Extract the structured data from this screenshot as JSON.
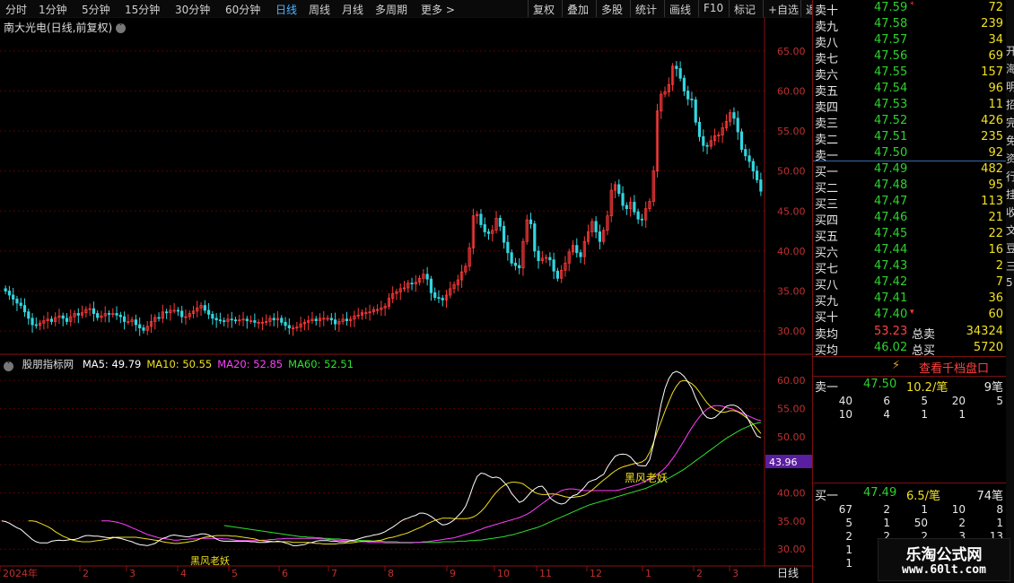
{
  "toolbar": {
    "periods": [
      "分时",
      "1分钟",
      "5分钟",
      "15分钟",
      "30分钟",
      "60分钟",
      "日线",
      "周线",
      "月线",
      "多周期",
      "更多 >"
    ],
    "active_period": "日线",
    "actions": [
      "复权",
      "叠加",
      "多股",
      "统计",
      "画线",
      "F10",
      "标记",
      "+自选",
      "返回"
    ]
  },
  "main_chart": {
    "title": "南大光电(日线,前复权)",
    "y_ticks": [
      "65.00",
      "60.00",
      "55.00",
      "50.00",
      "45.00",
      "40.00",
      "35.00",
      "30.00"
    ],
    "y_values": [
      65,
      60,
      55,
      50,
      45,
      40,
      35,
      30
    ],
    "ylim": [
      28,
      67
    ]
  },
  "indicator_chart": {
    "name": "股朋指标网",
    "ma_labels": [
      {
        "text": "MA5: 49.79",
        "color": "#ffffff"
      },
      {
        "text": "MA10: 50.55",
        "color": "#f0e020"
      },
      {
        "text": "MA20: 52.85",
        "color": "#ff40ff"
      },
      {
        "text": "MA60: 52.51",
        "color": "#30e030"
      }
    ],
    "y_ticks": [
      "60.00",
      "55.00",
      "50.00",
      "45.00",
      "40.00",
      "35.00",
      "30.00"
    ],
    "y_values": [
      60,
      55,
      50,
      45,
      40,
      35,
      30
    ],
    "ylim": [
      27,
      64
    ],
    "highlight_value": "43.96",
    "annotations": [
      "黑风老妖",
      "黑风老妖"
    ]
  },
  "x_axis": {
    "labels": [
      "2024年",
      "2",
      "3",
      "4",
      "5",
      "6",
      "7",
      "8",
      "9",
      "10",
      "11",
      "12",
      "1",
      "2",
      "3"
    ],
    "right_label": "日线"
  },
  "chart_data": [
    {
      "type": "candlestick",
      "title": "南大光电(日线,前复权)",
      "ylim": [
        28,
        67
      ],
      "months": [
        "2024年",
        "2",
        "3",
        "4",
        "5",
        "6",
        "7",
        "8",
        "9",
        "10",
        "11",
        "12",
        "1",
        "2",
        "3"
      ],
      "close": [
        35,
        34.5,
        34,
        33.5,
        33.2,
        32.4,
        31.6,
        30.8,
        30.7,
        31,
        31.3,
        31.5,
        31.2,
        31.7,
        31.9,
        31.6,
        31.2,
        31.8,
        32.2,
        32,
        32.3,
        32.7,
        32.8,
        32.2,
        31.7,
        31.9,
        32.2,
        32.1,
        32.2,
        32,
        31.8,
        31.2,
        31.2,
        31.4,
        30.8,
        30.4,
        30.1,
        30.6,
        31.2,
        31.7,
        31.6,
        32.4,
        32.3,
        32.6,
        32.6,
        32.5,
        31.8,
        31.8,
        32.2,
        32.5,
        32.9,
        33.2,
        32.6,
        32.1,
        31.6,
        31.4,
        31.3,
        31.2,
        31.5,
        31.4,
        31.3,
        31.4,
        31.5,
        31.3,
        31.3,
        31.1,
        31.1,
        31.1,
        31.2,
        31.6,
        31.4,
        31.6,
        31.1,
        30.7,
        30.4,
        30.4,
        30.5,
        30.9,
        31.1,
        31.3,
        31.5,
        31.3,
        31.6,
        31.6,
        31.6,
        31.4,
        30.9,
        31.2,
        31.5,
        31.3,
        31.5,
        31.9,
        32,
        32.3,
        32.3,
        32.4,
        32.7,
        32.7,
        32.9,
        33.1,
        34.1,
        34.7,
        34.9,
        35.3,
        35.4,
        36,
        35.9,
        36.1,
        36.6,
        37.1,
        36.5,
        34.8,
        34.2,
        34.1,
        33.9,
        34.5,
        35.3,
        35.8,
        36.4,
        37.4,
        38.1,
        40.4,
        44.4,
        44.6,
        43.3,
        42.4,
        42.2,
        42.6,
        44.1,
        43.1,
        41.1,
        39.8,
        38.5,
        38.2,
        37.9,
        41.2,
        43.9,
        43.4,
        40,
        38.8,
        39.1,
        39.2,
        38.9,
        37.5,
        36.6,
        37.6,
        38.5,
        39.9,
        40.7,
        39.8,
        39.3,
        41.2,
        42.4,
        43.7,
        42.4,
        41.2,
        42.6,
        44.4,
        47.6,
        48.3,
        47.2,
        45.7,
        45.3,
        46.1,
        44.9,
        44,
        43.9,
        45.3,
        46.2,
        50,
        57.5,
        59.6,
        59.9,
        60.8,
        63.1,
        62.8,
        61.6,
        60,
        59,
        58.9,
        56.1,
        54.3,
        53.2,
        53.1,
        53.8,
        54.4,
        54.5,
        55.4,
        56.2,
        57.3,
        56.6,
        54.9,
        52.7,
        51.9,
        51.2,
        50,
        48.9,
        47.49
      ],
      "ma5": [
        35,
        34.9,
        34.6,
        34.2,
        33.8,
        33.5,
        32.9,
        32.3,
        31.7,
        31.3,
        31.1,
        31.1,
        31.1,
        31.4,
        31.5,
        31.6,
        31.5,
        31.6,
        31.7,
        31.7,
        31.9,
        32.2,
        32.4,
        32.4,
        32.3,
        32.3,
        32.2,
        32.1,
        32,
        32.1,
        32,
        31.9,
        31.7,
        31.5,
        31.3,
        31.0,
        30.8,
        30.7,
        30.6,
        30.8,
        31.0,
        31.5,
        31.9,
        32.1,
        32.4,
        32.5,
        32.4,
        32.3,
        32.2,
        32.2,
        32.4,
        32.5,
        32.7,
        32.7,
        32.5,
        32.2,
        31.8,
        31.5,
        31.4,
        31.4,
        31.4,
        31.4,
        31.4,
        31.4,
        31.4,
        31.3,
        31.3,
        31.2,
        31.2,
        31.2,
        31.3,
        31.3,
        31.4,
        31.3,
        31.1,
        30.9,
        30.6,
        30.6,
        30.7,
        30.8,
        31.1,
        31.2,
        31.4,
        31.5,
        31.5,
        31.5,
        31.4,
        31.4,
        31.3,
        31.3,
        31.3,
        31.5,
        31.6,
        31.8,
        32,
        32.2,
        32.3,
        32.5,
        32.6,
        32.8,
        33.1,
        33.5,
        33.9,
        34.4,
        34.9,
        35.3,
        35.5,
        35.8,
        36,
        36.4,
        36.4,
        36.2,
        35.8,
        35.3,
        34.7,
        34.3,
        34.4,
        34.7,
        35.2,
        35.9,
        36.6,
        37.6,
        39.3,
        41.3,
        42.9,
        43.5,
        43.4,
        43,
        42.7,
        42.8,
        42.6,
        41.9,
        41.1,
        39.9,
        39.1,
        38.3,
        38.6,
        39.3,
        40.1,
        40.7,
        41.1,
        41.2,
        40.4,
        39.1,
        38.6,
        38.2,
        38,
        38.2,
        38.9,
        39.5,
        39.7,
        40.3,
        41,
        41.9,
        42.2,
        42.4,
        42.9,
        43.3,
        44.6,
        45.6,
        46.5,
        46.8,
        46.9,
        46.8,
        46.4,
        45.6,
        44.9,
        44.8,
        44.8,
        45.9,
        48.6,
        52.3,
        55.8,
        58.5,
        60.3,
        61.3,
        61.6,
        61.3,
        60.7,
        59.7,
        58.6,
        56.9,
        55.5,
        54.1,
        53.4,
        53.2,
        53.4,
        54,
        54.7,
        55.4,
        55.6,
        55.6,
        55.3,
        54.7,
        53.9,
        52.7,
        51.3,
        50.1,
        49.79
      ],
      "ma10": [
        35,
        35,
        34.9,
        34.6,
        34.3,
        34,
        33.6,
        33.1,
        32.7,
        32.3,
        32,
        31.7,
        31.5,
        31.4,
        31.3,
        31.3,
        31.3,
        31.4,
        31.5,
        31.6,
        31.7,
        31.8,
        32,
        32.1,
        32.1,
        32.1,
        32.1,
        32.1,
        32.1,
        32,
        31.9,
        31.8,
        31.7,
        31.6,
        31.5,
        31.3,
        31.2,
        31.1,
        31,
        31,
        31.1,
        31.2,
        31.3,
        31.4,
        31.6,
        31.9,
        32.1,
        32.2,
        32.3,
        32.4,
        32.4,
        32.4,
        32.4,
        32.3,
        32.3,
        32.2,
        32.1,
        32,
        31.9,
        31.8,
        31.6,
        31.5,
        31.4,
        31.4,
        31.3,
        31.3,
        31.3,
        31.3,
        31.3,
        31.2,
        31.2,
        31.2,
        31.2,
        31.2,
        31.1,
        31,
        31,
        30.9,
        30.9,
        30.9,
        30.9,
        31,
        31,
        31.1,
        31.1,
        31.2,
        31.3,
        31.4,
        31.4,
        31.4,
        31.4,
        31.5,
        31.6,
        31.8,
        32,
        32.1,
        32.3,
        32.5,
        32.7,
        32.9,
        33.2,
        33.5,
        33.8,
        34.1,
        34.5,
        34.8,
        35.1,
        35.3,
        35.5,
        35.5,
        35.5,
        35.4,
        35.4,
        35.4,
        35.4,
        35.5,
        35.7,
        36.1,
        36.7,
        37.4,
        38.3,
        39.3,
        40.1,
        40.8,
        41.3,
        41.7,
        41.9,
        41.9,
        41.8,
        41.6,
        41.1,
        40.6,
        40.1,
        39.8,
        39.7,
        39.7,
        39.8,
        39.8,
        39.7,
        39.5,
        39.3,
        39.2,
        39.2,
        39.3,
        39.4,
        39.6,
        40,
        40.5,
        41.1,
        41.7,
        42.3,
        42.8,
        43.4,
        43.9,
        44.3,
        44.6,
        44.8,
        45,
        45.2,
        45.3,
        45.5,
        46,
        47.2,
        48.9,
        50.9,
        52.7,
        54.5,
        56.2,
        57.8,
        59,
        59.8,
        60,
        59.8,
        59.4,
        58.8,
        57.9,
        56.9,
        56,
        55.3,
        54.8,
        54.5,
        54.3,
        54.4,
        54.6,
        54.6,
        54.4,
        54,
        53.5,
        52.9,
        52.2,
        51.4,
        50.55
      ],
      "ma20": [
        35,
        35,
        35,
        34.9,
        34.8,
        34.6,
        34.4,
        34.1,
        33.8,
        33.5,
        33.2,
        32.9,
        32.6,
        32.4,
        32.2,
        32,
        31.9,
        31.8,
        31.7,
        31.6,
        31.6,
        31.7,
        31.7,
        31.8,
        31.8,
        31.8,
        31.9,
        31.9,
        31.9,
        31.9,
        31.9,
        31.9,
        31.8,
        31.8,
        31.7,
        31.6,
        31.5,
        31.5,
        31.5,
        31.5,
        31.5,
        31.5,
        31.6,
        31.6,
        31.7,
        31.7,
        31.8,
        31.8,
        31.9,
        31.9,
        31.9,
        31.9,
        31.9,
        31.9,
        31.9,
        31.9,
        31.9,
        31.8,
        31.8,
        31.7,
        31.7,
        31.6,
        31.6,
        31.5,
        31.5,
        31.4,
        31.4,
        31.3,
        31.3,
        31.3,
        31.2,
        31.2,
        31.2,
        31.2,
        31.1,
        31.1,
        31.1,
        31.1,
        31.1,
        31.1,
        31.1,
        31.1,
        31.2,
        31.2,
        31.3,
        31.3,
        31.4,
        31.5,
        31.6,
        31.7,
        31.8,
        31.9,
        32,
        32.2,
        32.4,
        32.6,
        32.8,
        33,
        33.3,
        33.5,
        33.8,
        34,
        34.2,
        34.4,
        34.6,
        34.8,
        35,
        35.2,
        35.4,
        35.6,
        35.9,
        36.2,
        36.6,
        37.1,
        37.6,
        38.1,
        38.6,
        39.1,
        39.6,
        40,
        40.4,
        40.6,
        40.7,
        40.7,
        40.6,
        40.5,
        40.4,
        40.4,
        40.4,
        40.4,
        40.4,
        40.4,
        40.4,
        40.4,
        40.4,
        40.5,
        40.7,
        40.9,
        41.1,
        41.3,
        41.5,
        41.8,
        42.1,
        42.4,
        42.8,
        43.3,
        43.8,
        44.4,
        45.2,
        46.1,
        47.1,
        48.2,
        49.3,
        50.5,
        51.6,
        52.6,
        53.5,
        54.3,
        54.9,
        55.3,
        55.5,
        55.5,
        55.4,
        55.2,
        55,
        54.8,
        54.5,
        54.2,
        53.9,
        53.6,
        53.3,
        53,
        52.85
      ],
      "ma60": [
        34.2,
        34.1,
        34,
        33.9,
        33.8,
        33.7,
        33.6,
        33.5,
        33.4,
        33.3,
        33.2,
        33.1,
        33,
        32.9,
        32.8,
        32.7,
        32.6,
        32.5,
        32.4,
        32.3,
        32.2,
        32.2,
        32.1,
        32.1,
        32,
        32,
        31.9,
        31.9,
        31.8,
        31.8,
        31.8,
        31.7,
        31.7,
        31.6,
        31.6,
        31.6,
        31.5,
        31.5,
        31.5,
        31.4,
        31.4,
        31.4,
        31.3,
        31.3,
        31.3,
        31.3,
        31.2,
        31.2,
        31.2,
        31.2,
        31.2,
        31.2,
        31.2,
        31.2,
        31.2,
        31.2,
        31.2,
        31.3,
        31.3,
        31.3,
        31.3,
        31.4,
        31.4,
        31.4,
        31.5,
        31.5,
        31.6,
        31.6,
        31.7,
        31.8,
        31.9,
        32,
        32.1,
        32.2,
        32.4,
        32.5,
        32.7,
        32.9,
        33.1,
        33.3,
        33.5,
        33.7,
        33.9,
        34.2,
        34.5,
        34.8,
        35.1,
        35.4,
        35.7,
        36,
        36.3,
        36.6,
        36.9,
        37.2,
        37.5,
        37.8,
        38,
        38.2,
        38.4,
        38.6,
        38.8,
        39,
        39.2,
        39.4,
        39.6,
        39.8,
        40,
        40.2,
        40.4,
        40.6,
        40.8,
        41.1,
        41.4,
        41.7,
        42,
        42.3,
        42.6,
        43,
        43.4,
        43.8,
        44.2,
        44.7,
        45.2,
        45.7,
        46.2,
        46.7,
        47.2,
        47.7,
        48.2,
        48.7,
        49.2,
        49.7,
        50.1,
        50.5,
        50.9,
        51.3,
        51.6,
        51.9,
        52.2,
        52.4,
        52.51
      ]
    }
  ],
  "order_book": {
    "asks": [
      {
        "label": "卖十",
        "price": "47.59",
        "vol": "72",
        "mark": "*"
      },
      {
        "label": "卖九",
        "price": "47.58",
        "vol": "239"
      },
      {
        "label": "卖八",
        "price": "47.57",
        "vol": "34"
      },
      {
        "label": "卖七",
        "price": "47.56",
        "vol": "69"
      },
      {
        "label": "卖六",
        "price": "47.55",
        "vol": "157"
      },
      {
        "label": "卖五",
        "price": "47.54",
        "vol": "96"
      },
      {
        "label": "卖四",
        "price": "47.53",
        "vol": "11"
      },
      {
        "label": "卖三",
        "price": "47.52",
        "vol": "426"
      },
      {
        "label": "卖二",
        "price": "47.51",
        "vol": "235"
      },
      {
        "label": "卖一",
        "price": "47.50",
        "vol": "92"
      }
    ],
    "bids": [
      {
        "label": "买一",
        "price": "47.49",
        "vol": "482"
      },
      {
        "label": "买二",
        "price": "47.48",
        "vol": "95"
      },
      {
        "label": "买三",
        "price": "47.47",
        "vol": "113"
      },
      {
        "label": "买四",
        "price": "47.46",
        "vol": "21"
      },
      {
        "label": "买五",
        "price": "47.45",
        "vol": "22"
      },
      {
        "label": "买六",
        "price": "47.44",
        "vol": "16"
      },
      {
        "label": "买七",
        "price": "47.43",
        "vol": "2"
      },
      {
        "label": "买八",
        "price": "47.42",
        "vol": "7"
      },
      {
        "label": "买九",
        "price": "47.41",
        "vol": "36"
      },
      {
        "label": "买十",
        "price": "47.40",
        "vol": "60",
        "mark": "▾"
      }
    ],
    "summary": [
      {
        "label": "卖均",
        "price": "53.23",
        "label2": "总卖",
        "vol": "34324"
      },
      {
        "label": "买均",
        "price": "46.02",
        "label2": "总买",
        "vol": "5720"
      }
    ],
    "qiandang_button": "查看千档盘口",
    "sell_detail": {
      "label": "卖一",
      "price": "47.50",
      "per": "10.2/笔",
      "count": "9笔",
      "rows": [
        [
          "40",
          "6",
          "5",
          "20",
          "5"
        ],
        [
          "10",
          "4",
          "1",
          "1",
          ""
        ]
      ]
    },
    "buy_detail": {
      "label": "买一",
      "price": "47.49",
      "per": "6.5/笔",
      "count": "74笔",
      "rows": [
        [
          "67",
          "2",
          "1",
          "10",
          "8"
        ],
        [
          "5",
          "1",
          "50",
          "2",
          "1"
        ],
        [
          "2",
          "2",
          "2",
          "3",
          "13"
        ],
        [
          "1",
          "",
          "",
          "",
          ""
        ],
        [
          "1",
          "2",
          "",
          "",
          ""
        ]
      ]
    }
  },
  "right_strip_chars": [
    "开",
    "海",
    "明",
    "招",
    "完",
    "免",
    "资",
    "行",
    "挂",
    "收",
    "文",
    "豆",
    "三",
    "5"
  ],
  "watermark": {
    "title": "乐淘公式网",
    "url": "www.60lt.com"
  }
}
